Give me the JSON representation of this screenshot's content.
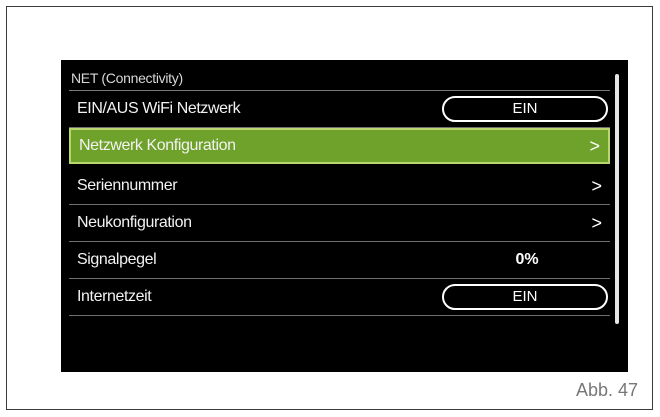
{
  "header": {
    "title": "NET (Connectivity)"
  },
  "menu": {
    "items": [
      {
        "label": "EIN/AUS WiFi Netzwerk",
        "kind": "toggle",
        "value": "EIN"
      },
      {
        "label": "Netzwerk Konfiguration",
        "kind": "link",
        "value": ">",
        "selected": true
      },
      {
        "label": "Seriennummer",
        "kind": "link",
        "value": ">"
      },
      {
        "label": "Neukonfiguration",
        "kind": "link",
        "value": ">"
      },
      {
        "label": "Signalpegel",
        "kind": "readout",
        "value": "0%"
      },
      {
        "label": "Internetzeit",
        "kind": "toggle",
        "value": "EIN"
      }
    ]
  },
  "caption": "Abb. 47",
  "colors": {
    "screen_background": "#000000",
    "selection_fill": "#6fa22a",
    "selection_border": "#b9d66f",
    "text": "#ffffff"
  }
}
